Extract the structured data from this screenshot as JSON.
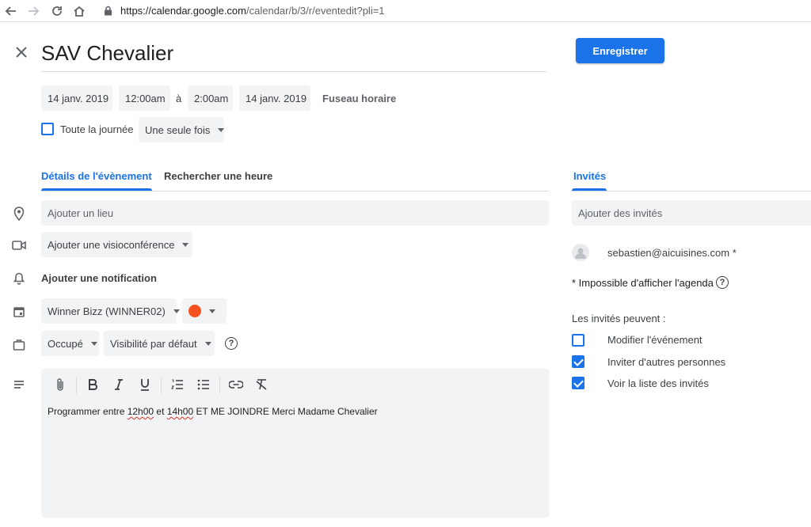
{
  "browser": {
    "url_host": "https://calendar.google.com",
    "url_path": "/calendar/b/3/r/eventedit?pli=1"
  },
  "event": {
    "title": "SAV Chevalier",
    "save_label": "Enregistrer",
    "start_date": "14 janv. 2019",
    "start_time": "12:00am",
    "to_label": "à",
    "end_time": "2:00am",
    "end_date": "14 janv. 2019",
    "timezone_label": "Fuseau horaire",
    "all_day_label": "Toute la journée",
    "all_day_checked": false,
    "repeat_value": "Une seule fois"
  },
  "tabs": {
    "details": "Détails de l'évènement",
    "find_time": "Rechercher une heure",
    "guests": "Invités"
  },
  "details": {
    "location_placeholder": "Ajouter un lieu",
    "conference_label": "Ajouter une visioconférence",
    "notification_label": "Ajouter une notification",
    "calendar_value": "Winner Bizz (WINNER02)",
    "event_color": "#f4511e",
    "availability_value": "Occupé",
    "visibility_value": "Visibilité par défaut",
    "description_parts": [
      "Programmer entre ",
      "12h00",
      " et ",
      "14h00",
      " ET ME JOINDRE Merci Madame Chevalier"
    ]
  },
  "guests": {
    "add_placeholder": "Ajouter des invités",
    "list": [
      {
        "email": "sebastien@aicuisines.com *"
      }
    ],
    "calendar_note": "* Impossible d'afficher l'agenda",
    "permissions_title": "Les invités peuvent :",
    "permissions": [
      {
        "label": "Modifier l'événement",
        "checked": false
      },
      {
        "label": "Inviter d'autres personnes",
        "checked": true
      },
      {
        "label": "Voir la liste des invités",
        "checked": true
      }
    ]
  },
  "colors": {
    "accent": "#1a73e8",
    "field_bg": "#f1f3f4"
  }
}
